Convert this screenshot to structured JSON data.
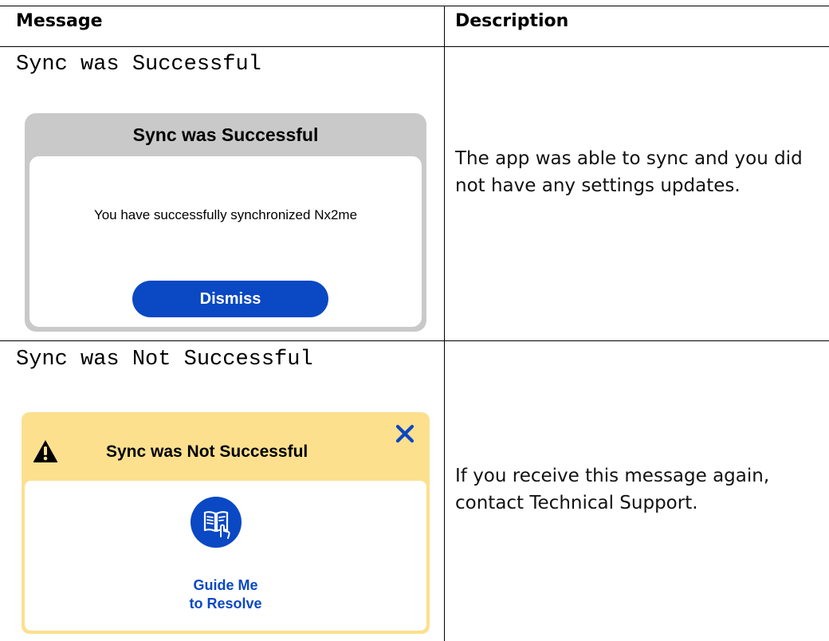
{
  "table": {
    "headers": {
      "message": "Message",
      "description": "Description"
    },
    "rows": [
      {
        "message": "Sync was Successful",
        "dialog": {
          "title": "Sync was Successful",
          "body": "You have successfully synchronized Nx2me",
          "button": "Dismiss"
        },
        "description": "The app was able to sync and you did not have any settings updates."
      },
      {
        "message": "Sync was Not Successful",
        "dialog": {
          "title": "Sync was Not Successful",
          "action_label": "Guide Me\nto Resolve",
          "icons": [
            "warning-icon",
            "close-icon",
            "guide-book-icon"
          ]
        },
        "description": "If you receive this message again, contact Technical Support."
      }
    ]
  },
  "colors": {
    "primary_blue": "#0a48c4",
    "warning_yellow": "#fce08e",
    "dialog_gray": "#c9c9c9"
  }
}
